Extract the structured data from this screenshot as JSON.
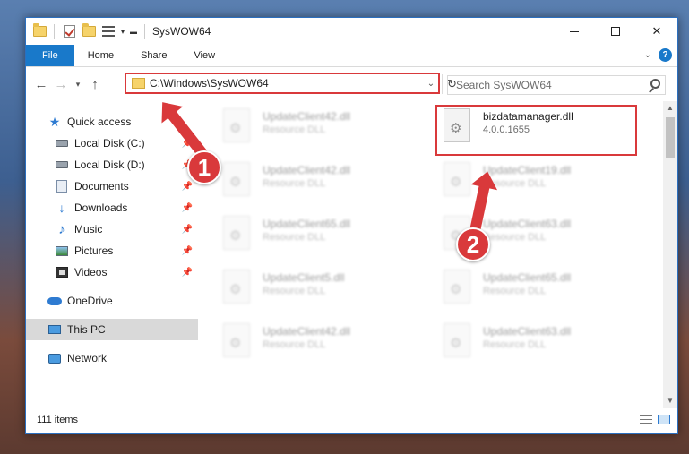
{
  "window": {
    "title": "SysWOW64"
  },
  "ribbon": {
    "tabs": [
      "File",
      "Home",
      "Share",
      "View"
    ]
  },
  "nav": {
    "address": "C:\\Windows\\SysWOW64",
    "search_placeholder": "Search SysWOW64"
  },
  "sidebar": {
    "items": [
      {
        "label": "Quick access",
        "icon": "star-icon"
      },
      {
        "label": "Local Disk (C:)",
        "icon": "disk-icon",
        "pinned": true
      },
      {
        "label": "Local Disk (D:)",
        "icon": "disk-icon",
        "pinned": true
      },
      {
        "label": "Documents",
        "icon": "documents-icon",
        "pinned": true
      },
      {
        "label": "Downloads",
        "icon": "download-icon",
        "pinned": true
      },
      {
        "label": "Music",
        "icon": "music-icon",
        "pinned": true
      },
      {
        "label": "Pictures",
        "icon": "pictures-icon",
        "pinned": true
      },
      {
        "label": "Videos",
        "icon": "videos-icon",
        "pinned": true
      },
      {
        "label": "OneDrive",
        "icon": "cloud-icon"
      },
      {
        "label": "This PC",
        "icon": "pc-icon",
        "selected": true
      },
      {
        "label": "Network",
        "icon": "network-icon"
      }
    ]
  },
  "files": {
    "highlighted": {
      "name": "bizdatamanager.dll",
      "sub": "4.0.0.1655"
    },
    "col1": [
      {
        "name": "UpdateClient42.dll",
        "sub": "Resource DLL"
      },
      {
        "name": "UpdateClient42.dll",
        "sub": "Resource DLL"
      },
      {
        "name": "UpdateClient65.dll",
        "sub": "Resource DLL"
      },
      {
        "name": "UpdateClient5.dll",
        "sub": "Resource DLL"
      },
      {
        "name": "UpdateClient42.dll",
        "sub": "Resource DLL"
      }
    ],
    "col2": [
      {
        "name": "UpdateClient19.dll",
        "sub": "Resource DLL"
      },
      {
        "name": "UpdateClient63.dll",
        "sub": "Resource DLL"
      },
      {
        "name": "UpdateClient65.dll",
        "sub": "Resource DLL"
      },
      {
        "name": "UpdateClient63.dll",
        "sub": "Resource DLL"
      }
    ]
  },
  "status": {
    "items": "111 items"
  },
  "annotations": {
    "badge1": "1",
    "badge2": "2",
    "color": "#d9393b"
  }
}
